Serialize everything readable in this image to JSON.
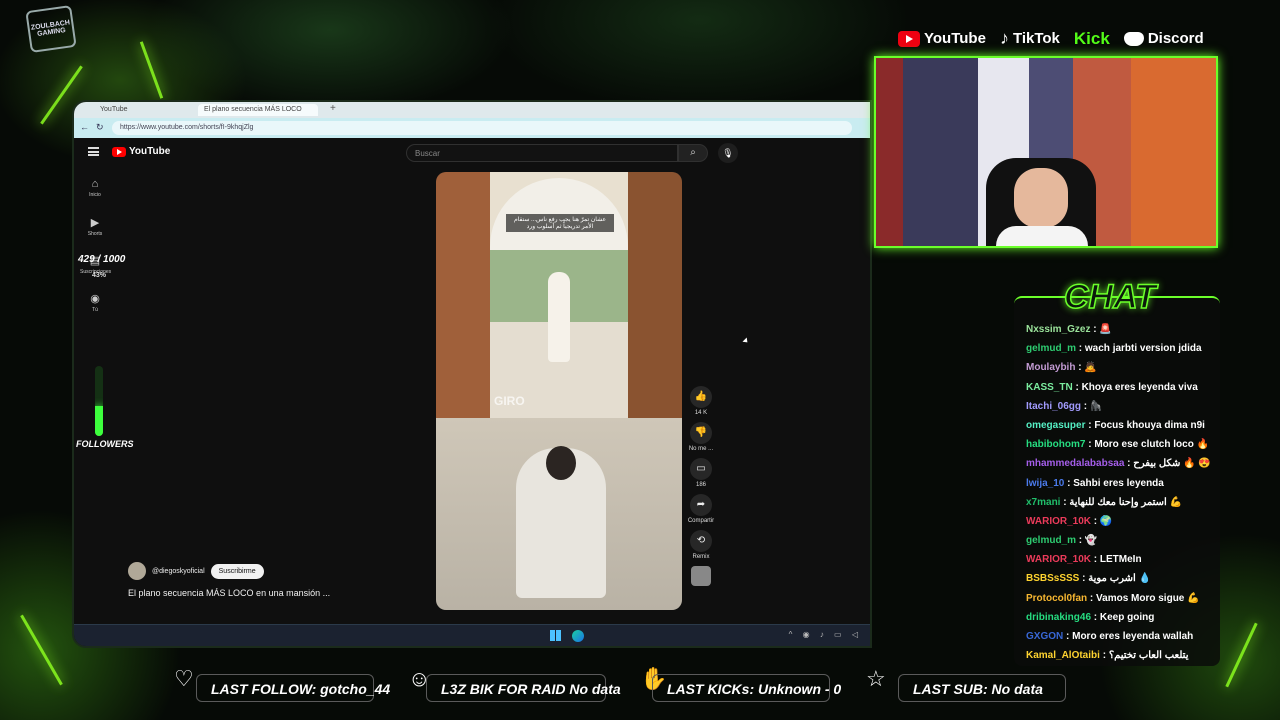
{
  "overlay": {
    "logo_text": "ZOULBACH GAMING",
    "socials": [
      {
        "icon": "youtube-icon",
        "label": "YouTube"
      },
      {
        "icon": "tiktok-icon",
        "label": "TikTok"
      },
      {
        "icon": "kick-icon",
        "label": "Kick"
      },
      {
        "icon": "discord-icon",
        "label": "Discord"
      }
    ],
    "follower_goal": {
      "text": "429 / 1000",
      "percent_text": "43%",
      "fraction": 0.43,
      "label": "FOLLOWERS"
    },
    "chat_title": "CHAT",
    "accent_color": "#6bff2a",
    "alerts": {
      "follow": "LAST FOLLOW: gotcho_44",
      "raid": "L3Z BIK FOR RAID No data",
      "kicks": "LAST KICKs: Unknown - 0",
      "sub": "LAST SUB: No data"
    }
  },
  "browser": {
    "tabs": [
      "YouTube",
      "El plano secuencia MÁS LOCO"
    ],
    "url": "https://www.youtube.com/shorts/fI-9khqjZlg"
  },
  "youtube": {
    "logo": "YouTube",
    "search_placeholder": "Buscar",
    "sidebar": [
      {
        "icon": "home-icon",
        "label": "Inicio"
      },
      {
        "icon": "shorts-icon",
        "label": "Shorts"
      },
      {
        "icon": "subscriptions-icon",
        "label": "Suscripciones"
      },
      {
        "icon": "you-icon",
        "label": "Tú"
      }
    ],
    "short": {
      "caption": "عشان تمرّ هنا يجب رفع ناس... ستقام الأمر تدريجياً ثم أسلوب ورد",
      "watermark": "GIRO",
      "channel": "@diegoskyoficial",
      "subscribe": "Suscribirme",
      "title": "El plano secuencia MÁS LOCO en una mansión ...",
      "actions": [
        {
          "icon": "like-icon",
          "label": "14 K"
        },
        {
          "icon": "dislike-icon",
          "label": "No me ..."
        },
        {
          "icon": "comment-icon",
          "label": "186"
        },
        {
          "icon": "share-icon",
          "label": "Compartir"
        },
        {
          "icon": "remix-icon",
          "label": "Remix"
        }
      ]
    }
  },
  "chat": [
    {
      "user": "Nxssim_Gzez",
      "color": "#9be39b",
      "text": "🚨"
    },
    {
      "user": "gelmud_m",
      "color": "#2ecc71",
      "text": "wach jarbti version jdida"
    },
    {
      "user": "Moulaybih",
      "color": "#c39bd3",
      "text": "🙇"
    },
    {
      "user": "KASS_TN",
      "color": "#7bed9f",
      "text": "Khoya eres leyenda viva"
    },
    {
      "user": "Itachi_06gg",
      "color": "#a29bfe",
      "text": "🦍"
    },
    {
      "user": "omegasuper",
      "color": "#55efc4",
      "text": "Focus khouya dima n9i"
    },
    {
      "user": "habibohom7",
      "color": "#26de81",
      "text": "Moro ese clutch loco 🔥"
    },
    {
      "user": "mhammedalababsaa",
      "color": "#a55eea",
      "text": "شكل بيفرح 🔥 😍"
    },
    {
      "user": "lwija_10",
      "color": "#4b7bec",
      "text": "Sahbi eres leyenda"
    },
    {
      "user": "x7mani",
      "color": "#20bf6b",
      "text": "استمر وإحنا معك للنهاية 💪"
    },
    {
      "user": "WARIOR_10K",
      "color": "#eb3b5a",
      "text": "🌍"
    },
    {
      "user": "gelmud_m",
      "color": "#2ecc71",
      "text": "👻"
    },
    {
      "user": "WARIOR_10K",
      "color": "#eb3b5a",
      "text": "LETMeIn"
    },
    {
      "user": "BSBSsSSS",
      "color": "#fed330",
      "text": "اشرب موية 💧"
    },
    {
      "user": "Protocol0fan",
      "color": "#f7b731",
      "text": "Vamos Moro sigue 💪"
    },
    {
      "user": "dribinaking46",
      "color": "#26de81",
      "text": "Keep going"
    },
    {
      "user": "GXGON",
      "color": "#3867d6",
      "text": "Moro eres leyenda wallah"
    },
    {
      "user": "Kamal_AlOtaibi",
      "color": "#fed330",
      "text": "يتلعب العاب تختيم؟"
    }
  ]
}
